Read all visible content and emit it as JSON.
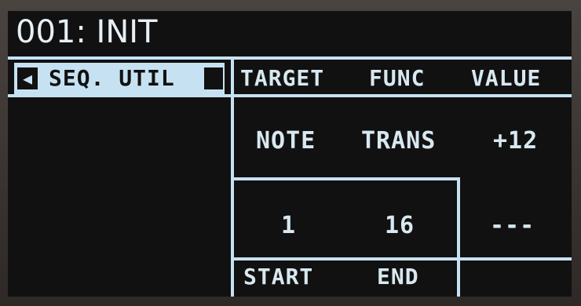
{
  "patch": {
    "title": "001: INIT"
  },
  "menu": {
    "back_icon": "◀",
    "label": "SEQ. UTIL"
  },
  "columns": {
    "target": "TARGET",
    "func": "FUNC",
    "value": "VALUE"
  },
  "row": {
    "target": "NOTE",
    "func": "TRANS",
    "value": "+12"
  },
  "range": {
    "start_value": "1",
    "end_value": "16",
    "value_placeholder": "---"
  },
  "range_labels": {
    "start": "START",
    "end": "END"
  }
}
